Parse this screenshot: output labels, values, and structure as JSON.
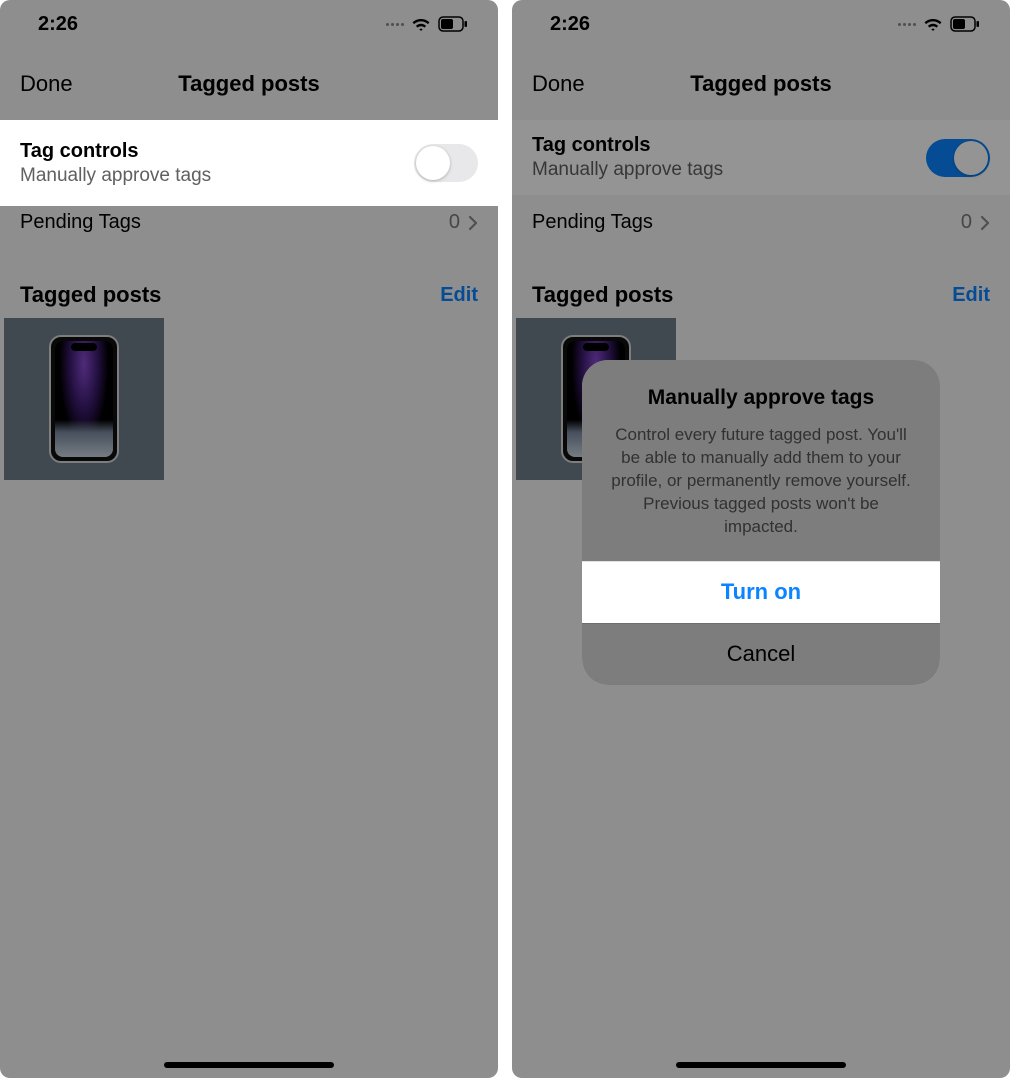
{
  "status": {
    "time": "2:26"
  },
  "nav": {
    "done": "Done",
    "title": "Tagged posts"
  },
  "tagControls": {
    "title": "Tag controls",
    "subtitle": "Manually approve tags"
  },
  "pending": {
    "label": "Pending Tags",
    "count": "0"
  },
  "tagged": {
    "header": "Tagged posts",
    "edit": "Edit"
  },
  "left": {
    "toggle_on": false
  },
  "right": {
    "toggle_on": true
  },
  "modal": {
    "title": "Manually approve tags",
    "desc": "Control every future tagged post. You'll be able to manually add them to your profile, or permanently remove yourself. Previous tagged posts won't be impacted.",
    "primary": "Turn on",
    "secondary": "Cancel"
  }
}
